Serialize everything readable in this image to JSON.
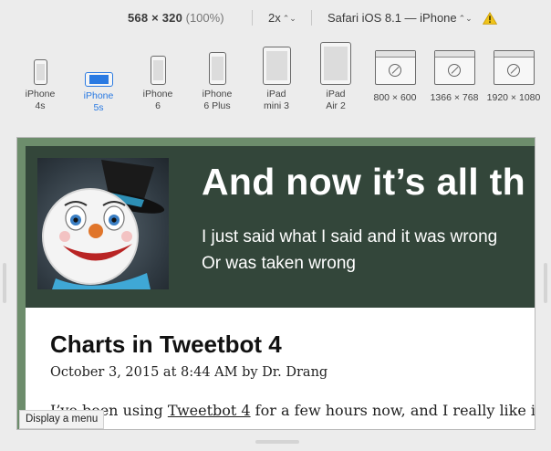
{
  "toolbar": {
    "dimensions": "568 × 320",
    "zoom": "(100%)",
    "scale": "2x",
    "user_agent": "Safari iOS 8.1 — iPhone",
    "warning_color": "#f0c419"
  },
  "devices": [
    {
      "line1": "iPhone",
      "line2": "4s",
      "kind": "phone",
      "active": false
    },
    {
      "line1": "iPhone",
      "line2": "5s",
      "kind": "phone-landscape",
      "active": true
    },
    {
      "line1": "iPhone",
      "line2": "6",
      "kind": "phone",
      "active": false
    },
    {
      "line1": "iPhone",
      "line2": "6 Plus",
      "kind": "phone",
      "active": false
    },
    {
      "line1": "iPad",
      "line2": "mini 3",
      "kind": "tablet",
      "active": false
    },
    {
      "line1": "iPad",
      "line2": "Air 2",
      "kind": "tablet",
      "active": false
    },
    {
      "line1": "800 × 600",
      "line2": "",
      "kind": "desktop",
      "active": false
    },
    {
      "line1": "1366 × 768",
      "line2": "",
      "kind": "desktop",
      "active": false
    },
    {
      "line1": "1920 × 1080",
      "line2": "",
      "kind": "desktop",
      "active": false
    }
  ],
  "site": {
    "title": "And now it’s all th",
    "tagline_line1": "I just said what I said and it was wrong",
    "tagline_line2": "Or was taken wrong",
    "header_color": "#33463a",
    "frame_color": "#6d8d6c"
  },
  "post": {
    "title": "Charts in Tweetbot 4",
    "meta": "October 3, 2015 at 8:44 AM by Dr. Drang",
    "body_before": "I’ve been using ",
    "body_link": "Tweetbot 4",
    "body_after": " for a few hours now, and I really like it."
  },
  "tooltip": "Display a menu",
  "accent_color": "#2a7ae2"
}
